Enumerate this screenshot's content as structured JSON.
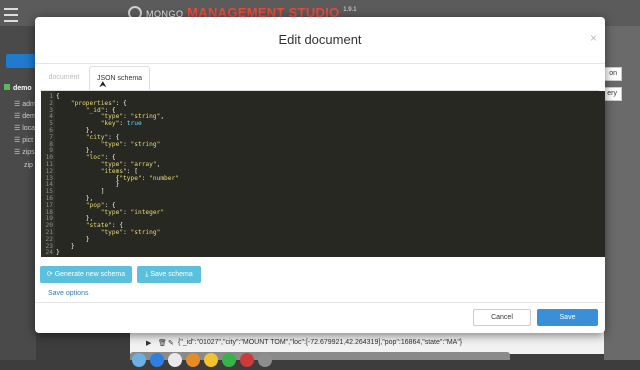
{
  "app": {
    "brand_mongo": "MONGO",
    "brand_ms": "MANAGEMENT STUDIO",
    "brand_version": "1.9.1"
  },
  "sidebar": {
    "db_label": "demo",
    "items": [
      {
        "label": "adm",
        "type": "collection"
      },
      {
        "label": "dem",
        "type": "collection"
      },
      {
        "label": "loca",
        "type": "collection"
      },
      {
        "label": "pict",
        "type": "collection"
      },
      {
        "label": "zips",
        "type": "collection"
      },
      {
        "label": "zip",
        "type": "sub"
      }
    ]
  },
  "background": {
    "right_button_1": "on",
    "right_button_2": "ery",
    "document_row": "{\"_id\":\"01027\",\"city\":\"MOUNT TOM\",\"loc\":[-72.679921,42.264319],\"pop\":16864,\"state\":\"MA\"}"
  },
  "modal": {
    "title": "Edit document",
    "close": "×",
    "tabs": [
      {
        "label": "document",
        "active": false
      },
      {
        "label": "JSON schema",
        "active": true
      }
    ],
    "code_lines": [
      {
        "n": "1",
        "t": "{"
      },
      {
        "n": "2",
        "t": "    \"properties\": {"
      },
      {
        "n": "3",
        "t": "        \"_id\": {"
      },
      {
        "n": "4",
        "t": "            \"type\": \"string\","
      },
      {
        "n": "5",
        "t": "            \"key\": true"
      },
      {
        "n": "6",
        "t": "        },"
      },
      {
        "n": "7",
        "t": "        \"city\": {"
      },
      {
        "n": "8",
        "t": "            \"type\": \"string\""
      },
      {
        "n": "9",
        "t": "        },"
      },
      {
        "n": "10",
        "t": "        \"loc\": {"
      },
      {
        "n": "11",
        "t": "            \"type\": \"array\","
      },
      {
        "n": "12",
        "t": "            \"items\": ["
      },
      {
        "n": "13",
        "t": "                {\"type\": \"number\""
      },
      {
        "n": "14",
        "t": "                }"
      },
      {
        "n": "15",
        "t": "            ]"
      },
      {
        "n": "16",
        "t": "        },"
      },
      {
        "n": "17",
        "t": "        \"pop\": {"
      },
      {
        "n": "18",
        "t": "            \"type\": \"integer\""
      },
      {
        "n": "19",
        "t": "        },"
      },
      {
        "n": "20",
        "t": "        \"state\": {"
      },
      {
        "n": "21",
        "t": "            \"type\": \"string\""
      },
      {
        "n": "22",
        "t": "        }"
      },
      {
        "n": "23",
        "t": "    }"
      },
      {
        "n": "24",
        "t": "}"
      }
    ],
    "generate_label": "Generate new schema",
    "save_schema_label": "Save schema",
    "save_options_label": "Save options",
    "cancel_label": "Cancel",
    "save_label": "Save",
    "colors": {
      "editor_bg": "#272822",
      "string": "#e6db74",
      "boolean": "#66d9ef",
      "info_button": "#5bc0de",
      "primary_button": "#3a8fd9",
      "brand_accent": "#e64a3c"
    }
  }
}
